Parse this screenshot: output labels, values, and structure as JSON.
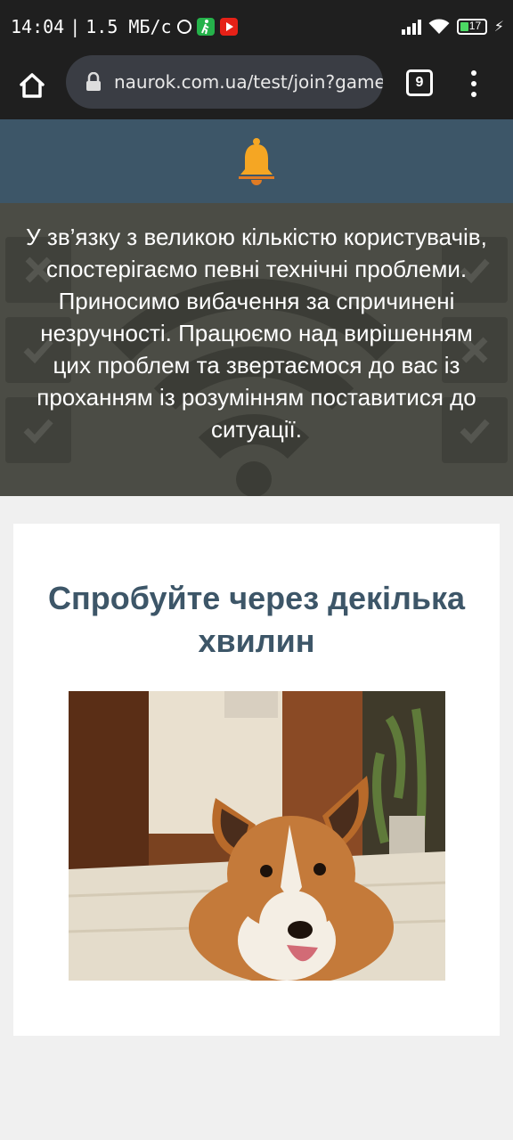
{
  "status_bar": {
    "time": "14:04",
    "separator": "|",
    "speed": "1.5 МБ/с",
    "battery_level": "17",
    "icons": [
      "alarm-icon",
      "walking-icon",
      "youtube-icon",
      "signal-icon",
      "wifi-icon",
      "battery-icon",
      "charging-icon"
    ]
  },
  "browser": {
    "url": "naurok.com.ua/test/join?gamecode",
    "tab_count": "9",
    "icons": [
      "home-icon",
      "lock-icon",
      "menu-icon"
    ]
  },
  "warning": {
    "message": "У зв’язку з великою кількістю користувачів, спостерігаємо певні технічні проблеми. Приносимо вибачення за спричинені незручності. Працюємо над вирішенням цих проблем та звертаємося до вас із проханням із розумінням поставитися до ситуації."
  },
  "card": {
    "title": "Спробуйте через декілька хвилин"
  },
  "colors": {
    "header": "#3d5668",
    "overlay": "#4b4c45",
    "bell": "#f5a623",
    "title": "#3d5668"
  }
}
